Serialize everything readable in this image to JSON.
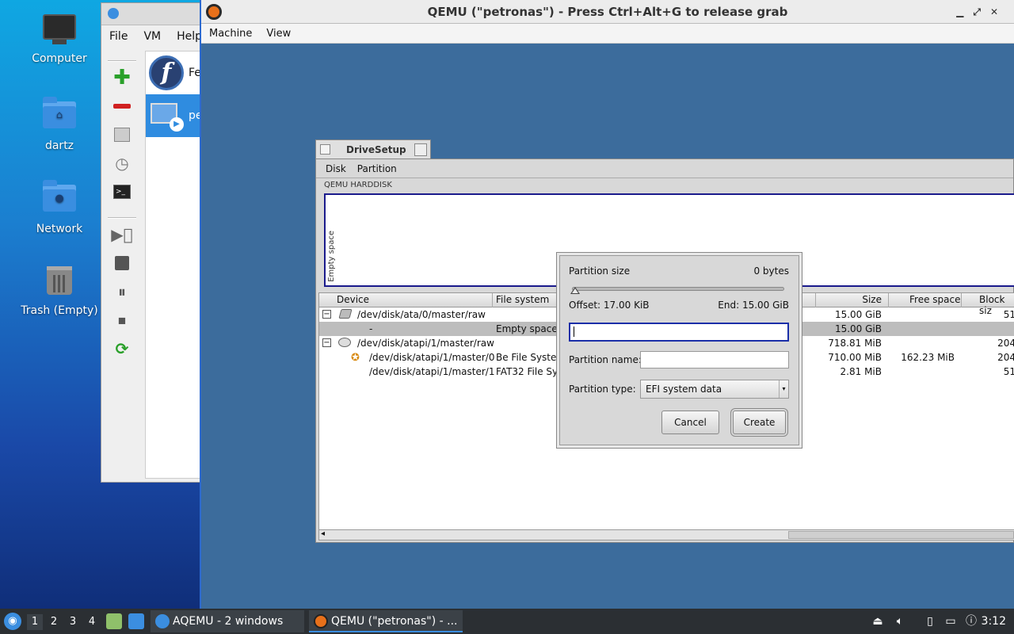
{
  "desktop": {
    "icons": [
      {
        "label": "Computer",
        "icon": "computer-icon"
      },
      {
        "label": "dartz",
        "icon": "home-folder-icon"
      },
      {
        "label": "Network",
        "icon": "network-folder-icon"
      },
      {
        "label": "Trash (Empty)",
        "icon": "trash-icon"
      }
    ]
  },
  "aqemu": {
    "menu": [
      "File",
      "VM",
      "Help"
    ],
    "vms": [
      {
        "name": "Fe",
        "icon": "fedora-icon"
      },
      {
        "name": "pe",
        "icon": "vm-running-icon"
      }
    ]
  },
  "qemu": {
    "title": "QEMU (\"petronas\") - Press Ctrl+Alt+G to release grab",
    "menu": [
      "Machine",
      "View"
    ]
  },
  "drivesetup": {
    "title": "DriveSetup",
    "menu": [
      "Disk",
      "Partition"
    ],
    "disk_label": "QEMU HARDDISK",
    "map_label": "Empty space",
    "columns": [
      "Device",
      "File system",
      "Size",
      "Free space",
      "Block siz"
    ],
    "rows": [
      {
        "expander": "⊟",
        "device": "/dev/disk/ata/0/master/raw",
        "fs": "",
        "size": "15.00 GiB",
        "free": "",
        "block": "51"
      },
      {
        "expander": "",
        "device": "-",
        "fs": "Empty space",
        "size": "15.00 GiB",
        "free": "",
        "block": ""
      },
      {
        "expander": "⊟",
        "device": "/dev/disk/atapi/1/master/raw",
        "fs": "",
        "size": "718.81 MiB",
        "free": "",
        "block": "204"
      },
      {
        "expander": "",
        "device": "/dev/disk/atapi/1/master/0",
        "fs": "Be File System",
        "size": "710.00 MiB",
        "free": "162.23 MiB",
        "block": "204"
      },
      {
        "expander": "",
        "device": "/dev/disk/atapi/1/master/1",
        "fs": "FAT32 File Syst",
        "size": "2.81 MiB",
        "free": "",
        "block": "51"
      }
    ]
  },
  "dialog": {
    "size_label": "Partition size",
    "size_value": "0 bytes",
    "slider_fraction": 0.0,
    "offset": "Offset: 17.00 KiB",
    "end": "End: 15.00 GiB",
    "size_input_value": "",
    "name_label": "Partition name:",
    "name_value": "",
    "type_label": "Partition type:",
    "type_value": "EFI system data",
    "cancel": "Cancel",
    "create": "Create"
  },
  "taskbar": {
    "workspaces": [
      "1",
      "2",
      "3",
      "4"
    ],
    "tasks": [
      {
        "label": "AQEMU - 2 windows",
        "active": false
      },
      {
        "label": "QEMU (\"petronas\") - ...",
        "active": true
      }
    ],
    "clock": "3:12"
  },
  "colors": {
    "accent": "#2f8ce0",
    "dialog_focus": "#1a2ea8",
    "desktop_top": "#0fa7e2",
    "desktop_bottom": "#0e2a72",
    "qemu_bg": "#3c6c9c"
  }
}
